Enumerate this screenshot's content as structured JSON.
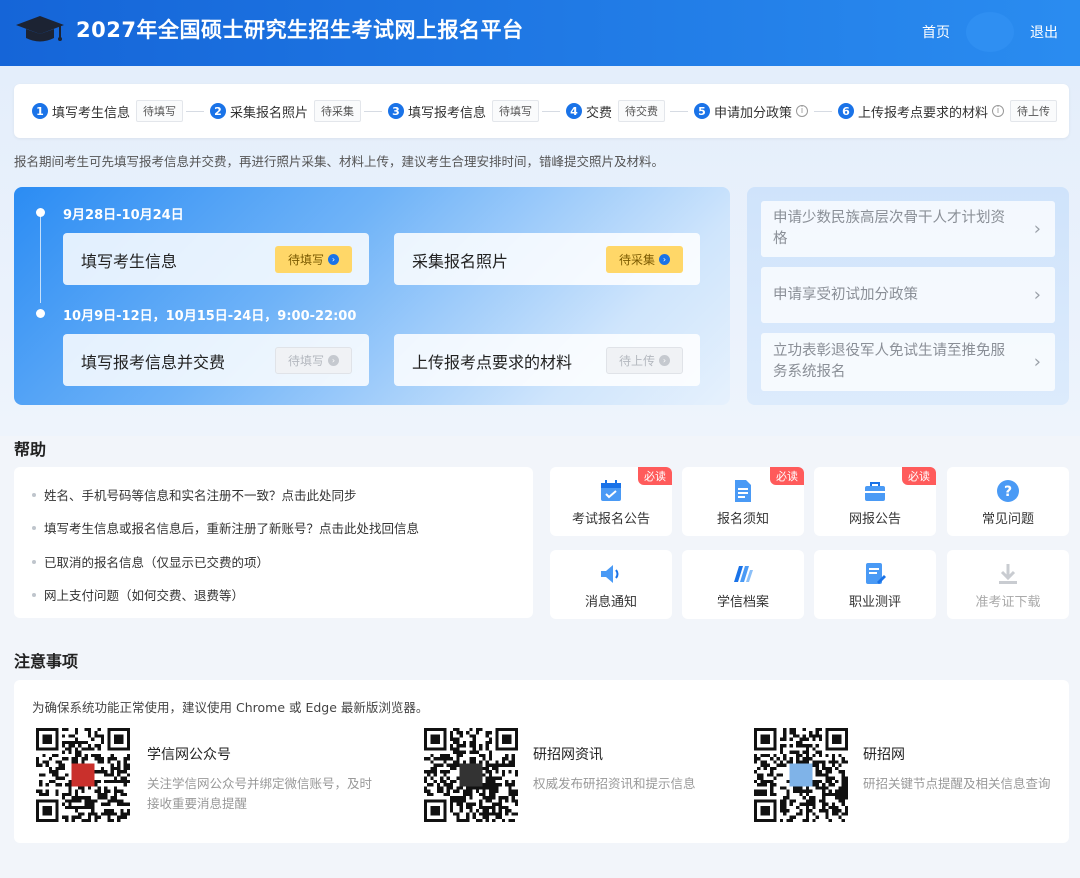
{
  "header": {
    "title": "2027年全国硕士研究生招生考试网上报名平台",
    "home": "首页",
    "logout": "退出",
    "logo_icon": "graduation-cap-icon"
  },
  "steps": [
    {
      "num": "1",
      "label": "填写考生信息",
      "status": "待填写"
    },
    {
      "num": "2",
      "label": "采集报名照片",
      "status": "待采集"
    },
    {
      "num": "3",
      "label": "填写报考信息",
      "status": "待填写"
    },
    {
      "num": "4",
      "label": "交费",
      "status": "待交费"
    },
    {
      "num": "5",
      "label": "申请加分政策",
      "status": ""
    },
    {
      "num": "6",
      "label": "上传报考点要求的材料",
      "status": "待上传"
    }
  ],
  "notice": "报名期间考生可先填写报考信息并交费，再进行照片采集、材料上传，建议考生合理安排时间，错峰提交照片及材料。",
  "timeline": {
    "period1": "9月28日-10月24日",
    "period2": "10月9日-12日，10月15日-24日，9:00-22:00",
    "tasks": [
      {
        "label": "填写考生信息",
        "btn": "待填写",
        "state": "active"
      },
      {
        "label": "采集报名照片",
        "btn": "待采集",
        "state": "active"
      },
      {
        "label": "填写报考信息并交费",
        "btn": "待填写",
        "state": "disabled"
      },
      {
        "label": "上传报考点要求的材料",
        "btn": "待上传",
        "state": "disabled"
      }
    ]
  },
  "side": [
    "申请少数民族高层次骨干人才计划资格",
    "申请享受初试加分政策",
    "立功表彰退役军人免试生请至推免服务系统报名"
  ],
  "help": {
    "title": "帮助",
    "items": [
      "姓名、手机号码等信息和实名注册不一致？点击此处同步",
      "填写考生信息或报名信息后，重新注册了新账号？点击此处找回信息",
      "已取消的报名信息（仅显示已交费的项）",
      "网上支付问题（如何交费、退费等）"
    ]
  },
  "tiles": [
    {
      "label": "考试报名公告",
      "badge": "必读",
      "icon": "calendar-icon"
    },
    {
      "label": "报名须知",
      "badge": "必读",
      "icon": "document-icon"
    },
    {
      "label": "网报公告",
      "badge": "必读",
      "icon": "briefcase-icon"
    },
    {
      "label": "常见问题",
      "badge": "",
      "icon": "question-icon"
    },
    {
      "label": "消息通知",
      "badge": "",
      "icon": "speaker-icon"
    },
    {
      "label": "学信档案",
      "badge": "",
      "icon": "files-icon"
    },
    {
      "label": "职业测评",
      "badge": "",
      "icon": "form-edit-icon"
    },
    {
      "label": "准考证下载",
      "badge": "",
      "icon": "download-icon"
    }
  ],
  "notes": {
    "title": "注意事项",
    "text": "为确保系统功能正常使用，建议使用 Chrome 或 Edge 最新版浏览器。",
    "qrs": [
      {
        "title": "学信网公众号",
        "desc": "关注学信网公众号并绑定微信账号，及时接收重要消息提醒"
      },
      {
        "title": "研招网资讯",
        "desc": "权威发布研招资讯和提示信息"
      },
      {
        "title": "研招网",
        "desc": "研招关键节点提醒及相关信息查询"
      }
    ]
  },
  "colors": {
    "primary": "#1a73e8",
    "badge": "#ff5b5b",
    "active_btn": "#ffd768"
  }
}
